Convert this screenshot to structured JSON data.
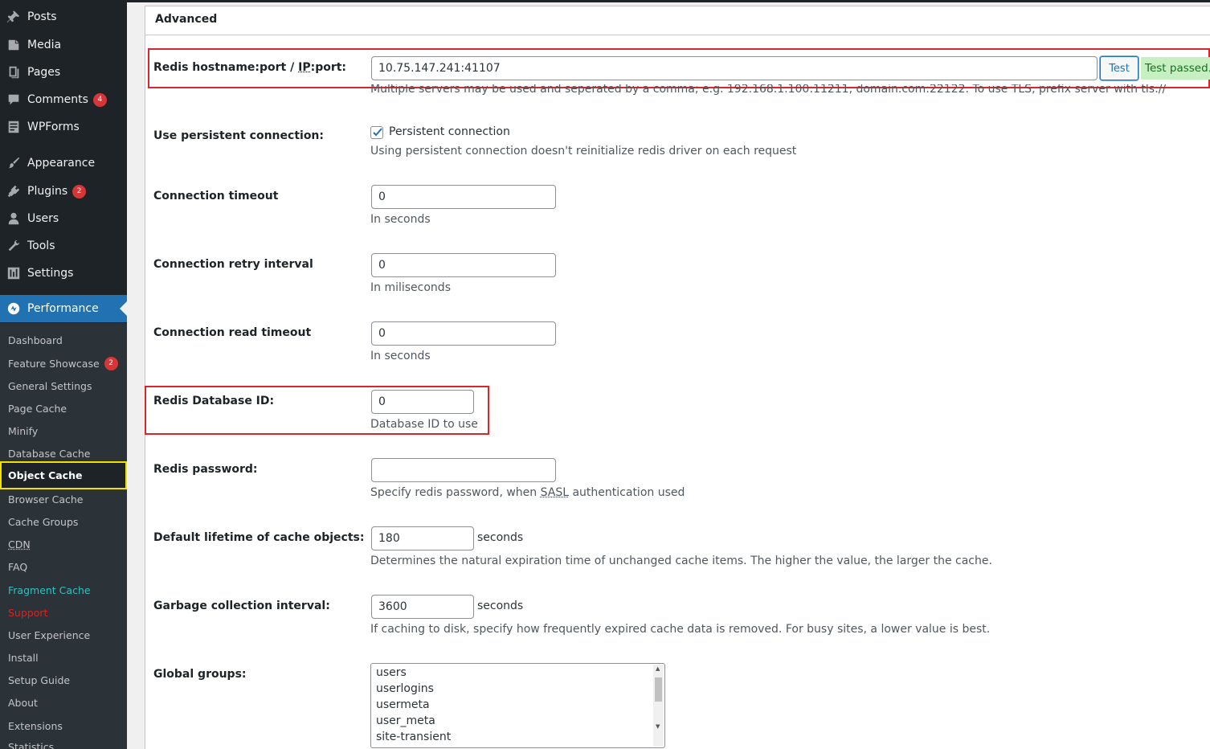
{
  "sidebar": {
    "menu": [
      {
        "label": "Posts",
        "icon": "pushpin-icon"
      },
      {
        "label": "Media",
        "icon": "media-icon"
      },
      {
        "label": "Pages",
        "icon": "pages-icon"
      },
      {
        "label": "Comments",
        "icon": "comments-icon",
        "badge": "4"
      },
      {
        "label": "WPForms",
        "icon": "forms-icon"
      },
      {
        "label": "Appearance",
        "icon": "brush-icon"
      },
      {
        "label": "Plugins",
        "icon": "plugin-icon",
        "badge": "2"
      },
      {
        "label": "Users",
        "icon": "user-icon"
      },
      {
        "label": "Tools",
        "icon": "wrench-icon"
      },
      {
        "label": "Settings",
        "icon": "settings-icon"
      },
      {
        "label": "Performance",
        "icon": "performance-icon"
      }
    ],
    "submenu": [
      {
        "label": "Dashboard"
      },
      {
        "label": "Feature Showcase",
        "badge": "2"
      },
      {
        "label": "General Settings"
      },
      {
        "label": "Page Cache"
      },
      {
        "label": "Minify"
      },
      {
        "label": "Database Cache"
      },
      {
        "label": "Object Cache"
      },
      {
        "label": "Browser Cache"
      },
      {
        "label": "Cache Groups"
      },
      {
        "label": "CDN"
      },
      {
        "label": "FAQ"
      },
      {
        "label": "Fragment Cache"
      },
      {
        "label": "Support"
      },
      {
        "label": "User Experience"
      },
      {
        "label": "Install"
      },
      {
        "label": "Setup Guide"
      },
      {
        "label": "About"
      },
      {
        "label": "Extensions"
      },
      {
        "label": "Statistics"
      }
    ]
  },
  "panel": {
    "title": "Advanced",
    "hostname": {
      "label_pre": "Redis hostname:port / ",
      "label_ip": "IP",
      "label_post": ":port:",
      "value": "10.75.147.241:41107",
      "test_button": "Test",
      "test_status": "Test passed.",
      "description": "Multiple servers may be used and seperated by a comma; e.g. 192.168.1.100:11211, domain.com:22122. To use TLS, prefix server with tls://"
    },
    "persistent": {
      "label": "Use persistent connection:",
      "checkbox_label": "Persistent connection",
      "checked": true,
      "description": "Using persistent connection doesn't reinitialize redis driver on each request"
    },
    "timeout": {
      "label": "Connection timeout",
      "value": "0",
      "description": "In seconds"
    },
    "retry": {
      "label": "Connection retry interval",
      "value": "0",
      "description": "In miliseconds"
    },
    "read_timeout": {
      "label": "Connection read timeout",
      "value": "0",
      "description": "In seconds"
    },
    "database_id": {
      "label": "Redis Database ID:",
      "value": "0",
      "description": "Database ID to use"
    },
    "password": {
      "label": "Redis password:",
      "value": "",
      "description_pre": "Specify redis password, when ",
      "description_sasl": "SASL",
      "description_post": " authentication used"
    },
    "lifetime": {
      "label": "Default lifetime of cache objects:",
      "value": "180",
      "unit": "seconds",
      "description": "Determines the natural expiration time of unchanged cache items. The higher the value, the larger the cache."
    },
    "gc": {
      "label": "Garbage collection interval:",
      "value": "3600",
      "unit": "seconds",
      "description": "If caching to disk, specify how frequently expired cache data is removed. For busy sites, a lower value is best."
    },
    "global_groups": {
      "label": "Global groups:",
      "items": [
        "users",
        "userlogins",
        "usermeta",
        "user_meta",
        "site-transient"
      ]
    }
  },
  "colors": {
    "sidebar_bg": "#1d2327",
    "submenu_bg": "#2c3338",
    "accent": "#2271b1",
    "badge": "#d63638",
    "highlight_box": "#d9262c",
    "current_outline": "#f0e100",
    "test_passed_bg": "#c6f0c2"
  }
}
